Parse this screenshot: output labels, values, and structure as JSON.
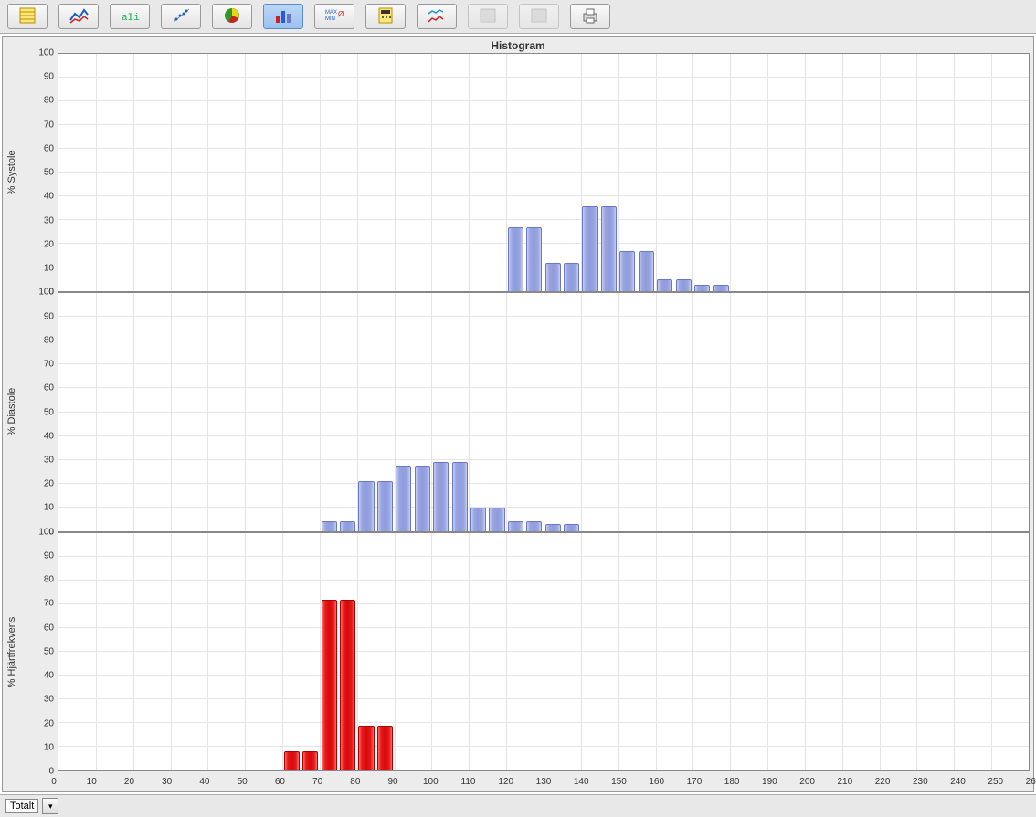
{
  "toolbar": {
    "buttons": [
      {
        "name": "tbtn-sheet",
        "active": false,
        "dim": false
      },
      {
        "name": "tbtn-line",
        "active": false,
        "dim": false
      },
      {
        "name": "tbtn-text",
        "active": false,
        "dim": false
      },
      {
        "name": "tbtn-scatter",
        "active": false,
        "dim": false
      },
      {
        "name": "tbtn-pie",
        "active": false,
        "dim": false
      },
      {
        "name": "tbtn-histogram",
        "active": true,
        "dim": false
      },
      {
        "name": "tbtn-maxmin",
        "active": false,
        "dim": false
      },
      {
        "name": "tbtn-calc",
        "active": false,
        "dim": false
      },
      {
        "name": "tbtn-multi",
        "active": false,
        "dim": false
      },
      {
        "name": "tbtn-gray1",
        "active": false,
        "dim": true
      },
      {
        "name": "tbtn-gray2",
        "active": false,
        "dim": true
      },
      {
        "name": "tbtn-print",
        "active": false,
        "dim": false
      }
    ]
  },
  "chart_title": "Histogram",
  "xaxis": {
    "min": 0,
    "max": 260,
    "step": 10
  },
  "yaxis": {
    "min": 0,
    "max": 100,
    "step": 10
  },
  "chart_data": [
    {
      "type": "bar",
      "ylabel": "% Systole",
      "color": "blue",
      "ylim": [
        0,
        100
      ],
      "bin_width": 10,
      "categories": [
        120,
        130,
        140,
        150,
        160,
        170
      ],
      "values": [
        27,
        12,
        36,
        17,
        5,
        3
      ]
    },
    {
      "type": "bar",
      "ylabel": "% Diastole",
      "color": "blue",
      "ylim": [
        0,
        100
      ],
      "bin_width": 10,
      "categories": [
        70,
        80,
        90,
        100,
        110,
        120,
        130
      ],
      "values": [
        4,
        21,
        27,
        29,
        10,
        4,
        3
      ]
    },
    {
      "type": "bar",
      "ylabel": "% Hjärtfrekvens",
      "color": "red",
      "ylim": [
        0,
        100
      ],
      "bin_width": 10,
      "categories": [
        60,
        70,
        80
      ],
      "values": [
        8,
        72,
        19
      ]
    }
  ],
  "bottom": {
    "select_label": "Totalt"
  }
}
